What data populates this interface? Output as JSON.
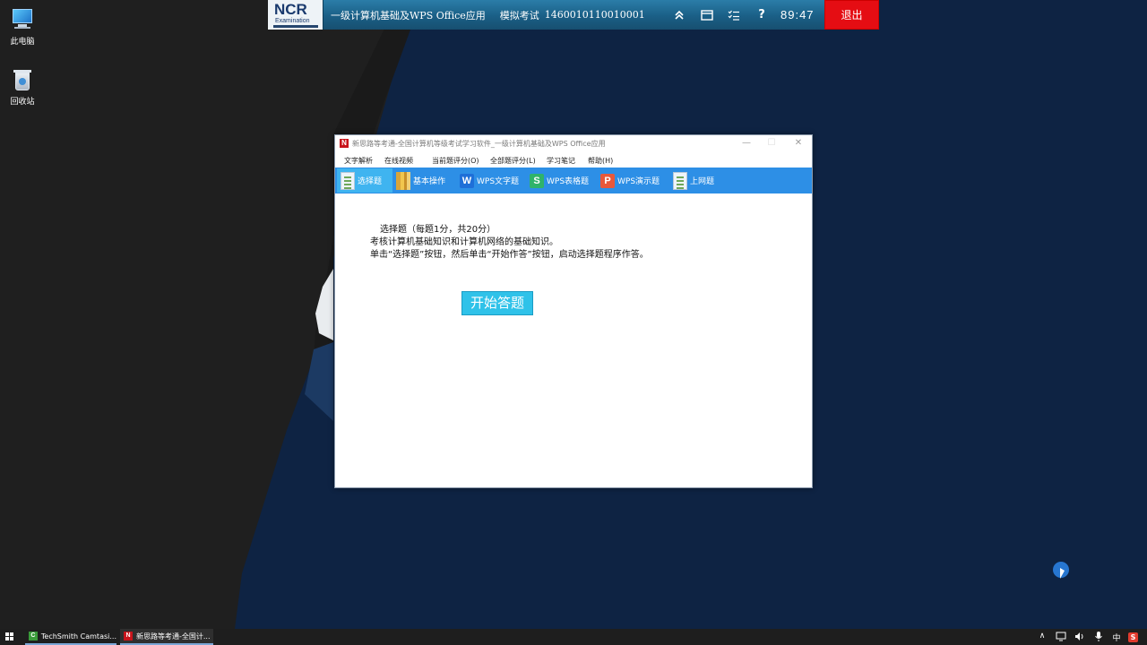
{
  "desktop": {
    "icons": [
      {
        "label": "此电脑",
        "icon": "computer-icon"
      },
      {
        "label": "回收站",
        "icon": "recycle-bin-icon"
      }
    ]
  },
  "exam_bar": {
    "logo_text": "NCR",
    "logo_sub": "Examination",
    "subject": "一级计算机基础及WPS Office应用",
    "mode": "模拟考试",
    "exam_id": "1460010110010001",
    "icons": [
      "collapse-up-icon",
      "window-icon",
      "checklist-icon",
      "help-icon"
    ],
    "help_label": "?",
    "timer": "89:47",
    "exit_label": "退出",
    "colors": {
      "bar": "#1a5f86",
      "exit": "#e50d13"
    }
  },
  "window": {
    "title": "新思路等考通-全国计算机等级考试学习软件_一级计算机基础及WPS Office应用",
    "logo_letter": "N",
    "controls": {
      "minimize": "—",
      "maximize": "☐",
      "close": "✕"
    },
    "menu": [
      "文字解析",
      "在线视频",
      "当前题评分(O)",
      "全部题评分(L)",
      "学习笔记",
      "帮助(H)"
    ],
    "toolbar": [
      {
        "label": "选择题",
        "icon": "document-icon",
        "active": true
      },
      {
        "label": "基本操作",
        "icon": "books-icon",
        "active": false
      },
      {
        "label": "WPS文字题",
        "icon": "wps-writer-icon",
        "glyph": "W",
        "active": false
      },
      {
        "label": "WPS表格题",
        "icon": "wps-spreadsheet-icon",
        "glyph": "S",
        "active": false
      },
      {
        "label": "WPS演示题",
        "icon": "wps-presentation-icon",
        "glyph": "P",
        "active": false
      },
      {
        "label": "上网题",
        "icon": "document-icon",
        "active": false
      }
    ],
    "content": {
      "line1": "选择题（每题1分，共20分）",
      "line2": "考核计算机基础知识和计算机网络的基础知识。",
      "line3": "单击“选择题”按钮，然后单击“开始作答”按钮，启动选择题程序作答。",
      "start_label": "开始答题"
    },
    "colors": {
      "toolbar": "#2d8fe6",
      "active_tab": "#3fb4f0",
      "start_button": "#2fc2e9"
    }
  },
  "taskbar": {
    "items": [
      {
        "label": "TechSmith Camtasi...",
        "icon": "camtasia-icon",
        "glyph": "C"
      },
      {
        "label": "新思路等考通-全国计...",
        "icon": "app-n-icon",
        "glyph": "N"
      }
    ],
    "tray": {
      "chevron": "∧",
      "ime": "中",
      "app": "S"
    }
  }
}
